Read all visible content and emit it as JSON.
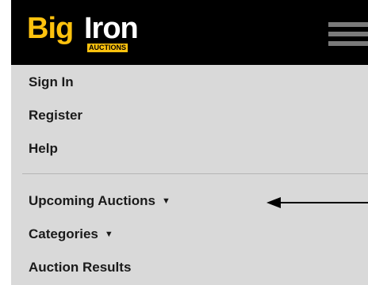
{
  "logo": {
    "brand_part1": "Big",
    "brand_part2": "Iron",
    "tagline": "AUCTIONS"
  },
  "header": {
    "menu_icon": "hamburger-menu-icon"
  },
  "menu": {
    "items": [
      {
        "label": "Sign In"
      },
      {
        "label": "Register"
      },
      {
        "label": "Help"
      },
      {
        "label": "Upcoming Auctions",
        "has_dropdown": true
      },
      {
        "label": "Categories",
        "has_dropdown": true
      },
      {
        "label": "Auction Results"
      }
    ],
    "dropdown_icon": "caret-down-icon"
  },
  "annotation": {
    "arrow_icon": "left-arrow-icon"
  },
  "colors": {
    "header_bg": "#000000",
    "brand_yellow": "#ffc20e",
    "menu_bg": "#d9d9d9",
    "text": "#1a1a1a"
  }
}
